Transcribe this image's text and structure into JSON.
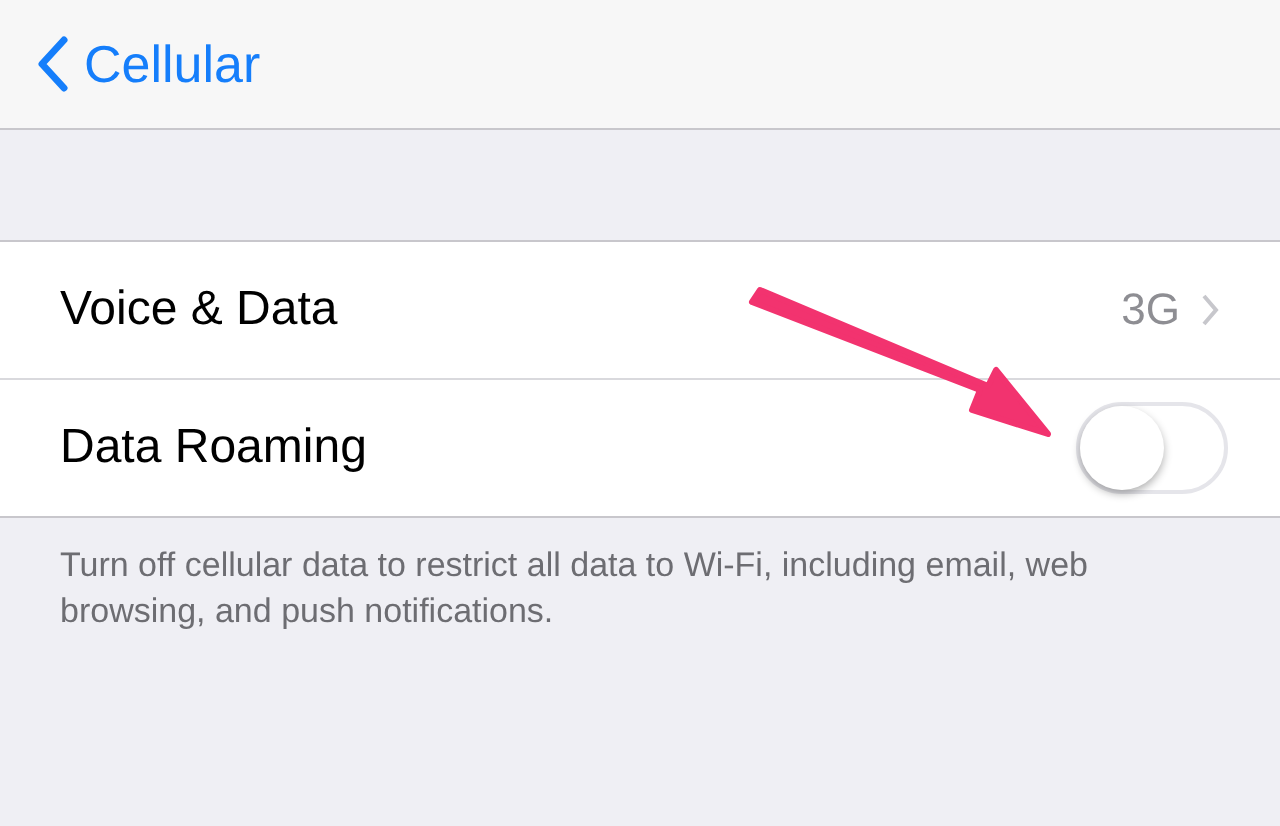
{
  "nav": {
    "back_label": "Cellular"
  },
  "rows": [
    {
      "kind": "detail",
      "label": "Voice & Data",
      "value": "3G"
    },
    {
      "kind": "toggle",
      "label": "Data Roaming",
      "on": false
    }
  ],
  "footer": "Turn off cellular data to restrict all data to Wi-Fi, including email, web browsing, and push notifications."
}
